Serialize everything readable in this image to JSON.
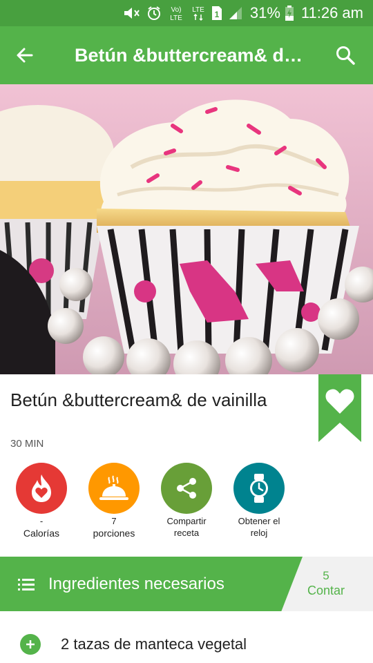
{
  "status_bar": {
    "network": "LTE",
    "volte": "Vo) LTE",
    "sim": "1",
    "battery_percent": "31%",
    "time": "11:26 am",
    "icons": [
      "mute-icon",
      "alarm-icon",
      "volte-icon",
      "lte-icon",
      "sim-icon",
      "signal-icon",
      "battery-icon"
    ]
  },
  "app_bar": {
    "title": "Betún &buttercream& d…",
    "back_icon": "arrow-left-icon",
    "search_icon": "search-icon"
  },
  "hero": {
    "subject": "cupcake-with-buttercream-photo"
  },
  "recipe": {
    "title": "Betún &buttercream& de vainilla",
    "time": "30 MIN",
    "favorite_icon": "heart-icon"
  },
  "actions": [
    {
      "value": "-",
      "label": "Calorías",
      "icon": "calorie-flame-icon",
      "color": "#e53935"
    },
    {
      "value": "7",
      "label": "porciones",
      "icon": "serving-dish-icon",
      "color": "#ff9800"
    },
    {
      "value": "",
      "label": "Compartir receta",
      "icon": "share-icon",
      "color": "#689f38"
    },
    {
      "value": "",
      "label": "Obtener el reloj",
      "icon": "watch-icon",
      "color": "#00838f"
    }
  ],
  "ingredients": {
    "title": "Ingredientes necesarios",
    "count": "5",
    "count_label": "Contar",
    "items": [
      "2 tazas de manteca vegetal"
    ]
  },
  "colors": {
    "status_bar": "#48a03f",
    "primary": "#54b34a"
  }
}
